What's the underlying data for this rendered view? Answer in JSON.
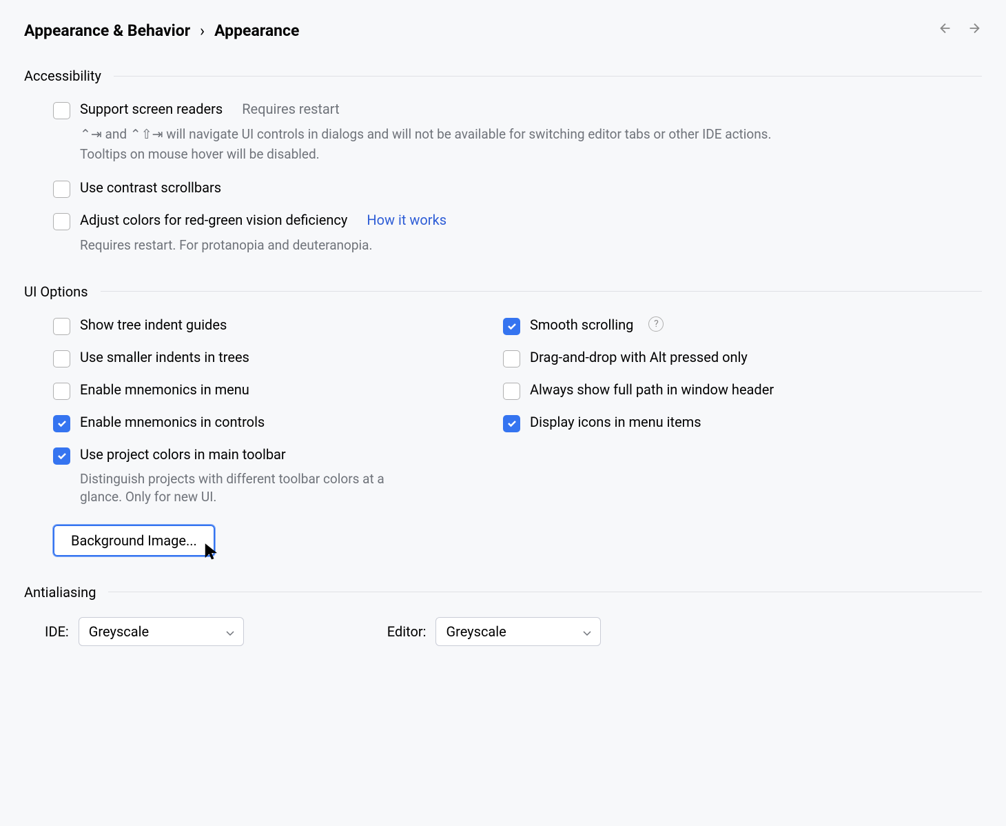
{
  "breadcrumb": {
    "parent": "Appearance & Behavior",
    "current": "Appearance"
  },
  "sections": {
    "accessibility": {
      "title": "Accessibility",
      "support_readers": {
        "label": "Support screen readers",
        "hint": "Requires restart",
        "description": "⌃⇥ and ⌃⇧⇥ will navigate UI controls in dialogs and will not be available for switching editor tabs or other IDE actions. Tooltips on mouse hover will be disabled.",
        "checked": false
      },
      "contrast_scrollbars": {
        "label": "Use contrast scrollbars",
        "checked": false
      },
      "color_adjust": {
        "label": "Adjust colors for red-green vision deficiency",
        "link": "How it works",
        "description": "Requires restart. For protanopia and deuteranopia.",
        "checked": false
      }
    },
    "ui_options": {
      "title": "UI Options",
      "tree_indent": {
        "label": "Show tree indent guides",
        "checked": false
      },
      "smaller_indents": {
        "label": "Use smaller indents in trees",
        "checked": false
      },
      "mnemonics_menu": {
        "label": "Enable mnemonics in menu",
        "checked": false
      },
      "mnemonics_controls": {
        "label": "Enable mnemonics in controls",
        "checked": true
      },
      "project_colors": {
        "label": "Use project colors in main toolbar",
        "description": "Distinguish projects with different toolbar colors at a glance. Only for new UI.",
        "checked": true
      },
      "smooth_scrolling": {
        "label": "Smooth scrolling",
        "checked": true
      },
      "drag_drop_alt": {
        "label": "Drag-and-drop with Alt pressed only",
        "checked": false
      },
      "full_path_header": {
        "label": "Always show full path in window header",
        "checked": false
      },
      "menu_icons": {
        "label": "Display icons in menu items",
        "checked": true
      },
      "background_image_btn": "Background Image..."
    },
    "antialiasing": {
      "title": "Antialiasing",
      "ide_label": "IDE:",
      "ide_value": "Greyscale",
      "editor_label": "Editor:",
      "editor_value": "Greyscale"
    }
  }
}
